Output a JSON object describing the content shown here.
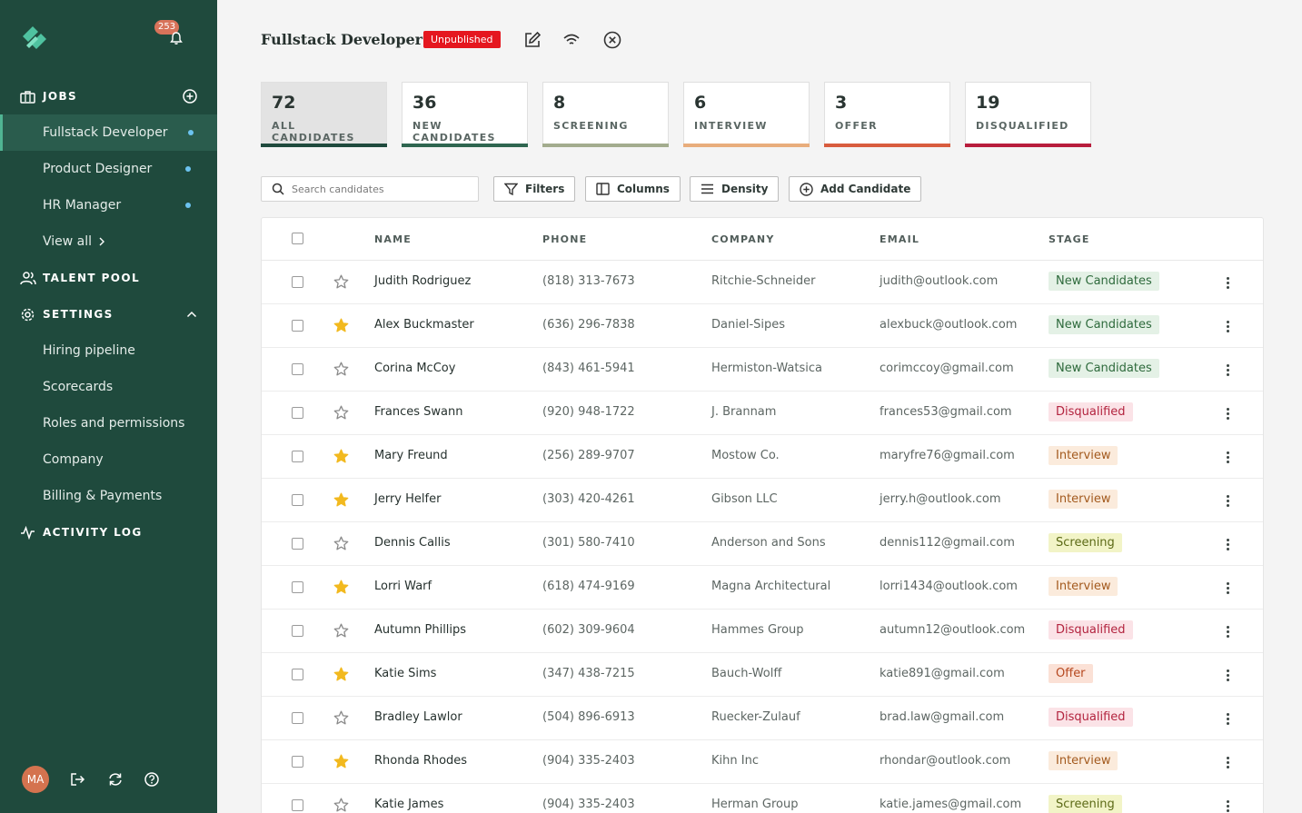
{
  "sidebar": {
    "notification_count": "253",
    "jobs_label": "JOBS",
    "job_items": [
      {
        "label": "Fullstack Developer"
      },
      {
        "label": "Product Designer"
      },
      {
        "label": "HR Manager"
      }
    ],
    "view_all": "View all",
    "talent_pool_label": "TALENT POOL",
    "settings_label": "SETTINGS",
    "settings_items": [
      {
        "label": "Hiring pipeline"
      },
      {
        "label": "Scorecards"
      },
      {
        "label": "Roles and permissions"
      },
      {
        "label": "Company"
      },
      {
        "label": "Billing & Payments"
      }
    ],
    "activity_log_label": "ACTIVITY LOG",
    "user_initials": "MA"
  },
  "header": {
    "title": "Fullstack Developer",
    "status_badge": "Unpublished"
  },
  "stages": [
    {
      "count": "72",
      "label": "ALL CANDIDATES",
      "color": "#1f4a3d"
    },
    {
      "count": "36",
      "label": "NEW CANDIDATES",
      "color": "#2f6650"
    },
    {
      "count": "8",
      "label": "SCREENING",
      "color": "#a3ac8e"
    },
    {
      "count": "6",
      "label": "INTERVIEW",
      "color": "#e8ad7c"
    },
    {
      "count": "3",
      "label": "OFFER",
      "color": "#d85c3e"
    },
    {
      "count": "19",
      "label": "DISQUALIFIED",
      "color": "#b81d3c"
    }
  ],
  "toolbar": {
    "search_placeholder": "Search candidates",
    "filters_label": "Filters",
    "columns_label": "Columns",
    "density_label": "Density",
    "add_candidate_label": "Add Candidate"
  },
  "table": {
    "headers": {
      "name": "NAME",
      "phone": "PHONE",
      "company": "COMPANY",
      "email": "EMAIL",
      "stage": "STAGE"
    },
    "rows": [
      {
        "name": "Judith Rodriguez",
        "phone": "(818) 313-7673",
        "company": "Ritchie-Schneider",
        "email": "judith@outlook.com",
        "stage": "New Candidates",
        "starred": false
      },
      {
        "name": "Alex Buckmaster",
        "phone": "(636) 296-7838",
        "company": "Daniel-Sipes",
        "email": "alexbuck@outlook.com",
        "stage": "New Candidates",
        "starred": true
      },
      {
        "name": "Corina McCoy",
        "phone": "(843) 461-5941",
        "company": "Hermiston-Watsica",
        "email": "corimccoy@gmail.com",
        "stage": "New Candidates",
        "starred": false
      },
      {
        "name": "Frances Swann",
        "phone": "(920) 948-1722",
        "company": "J. Brannam",
        "email": "frances53@gmail.com",
        "stage": "Disqualified",
        "starred": false
      },
      {
        "name": "Mary Freund",
        "phone": "(256) 289-9707",
        "company": "Mostow Co.",
        "email": "maryfre76@gmail.com",
        "stage": "Interview",
        "starred": true
      },
      {
        "name": "Jerry Helfer",
        "phone": "(303) 420-4261",
        "company": "Gibson LLC",
        "email": "jerry.h@outlook.com",
        "stage": "Interview",
        "starred": true
      },
      {
        "name": "Dennis Callis",
        "phone": "(301) 580-7410",
        "company": "Anderson and Sons",
        "email": "dennis112@gmail.com",
        "stage": "Screening",
        "starred": false
      },
      {
        "name": "Lorri Warf",
        "phone": "(618) 474-9169",
        "company": "Magna Architectural",
        "email": "lorri1434@outlook.com",
        "stage": "Interview",
        "starred": true
      },
      {
        "name": "Autumn Phillips",
        "phone": "(602) 309-9604",
        "company": "Hammes Group",
        "email": "autumn12@outlook.com",
        "stage": "Disqualified",
        "starred": false
      },
      {
        "name": "Katie Sims",
        "phone": "(347) 438-7215",
        "company": "Bauch-Wolff",
        "email": "katie891@gmail.com",
        "stage": "Offer",
        "starred": true
      },
      {
        "name": "Bradley Lawlor",
        "phone": "(504) 896-6913",
        "company": "Ruecker-Zulauf",
        "email": "brad.law@gmail.com",
        "stage": "Disqualified",
        "starred": false
      },
      {
        "name": "Rhonda Rhodes",
        "phone": "(904) 335-2403",
        "company": "Kihn Inc",
        "email": "rhondar@outlook.com",
        "stage": "Interview",
        "starred": true
      },
      {
        "name": "Katie James",
        "phone": "(904) 335-2403",
        "company": "Herman Group",
        "email": "katie.james@gmail.com",
        "stage": "Screening",
        "starred": false
      }
    ]
  },
  "stage_styles": {
    "New Candidates": {
      "bg": "#e4f1e6",
      "fg": "#2e6a3c"
    },
    "Disqualified": {
      "bg": "#fbe3e7",
      "fg": "#b3243f"
    },
    "Interview": {
      "bg": "#fbebdc",
      "fg": "#a35a1e"
    },
    "Screening": {
      "bg": "#f2f4c7",
      "fg": "#5c6a16"
    },
    "Offer": {
      "bg": "#fbe1d6",
      "fg": "#b6481f"
    }
  }
}
